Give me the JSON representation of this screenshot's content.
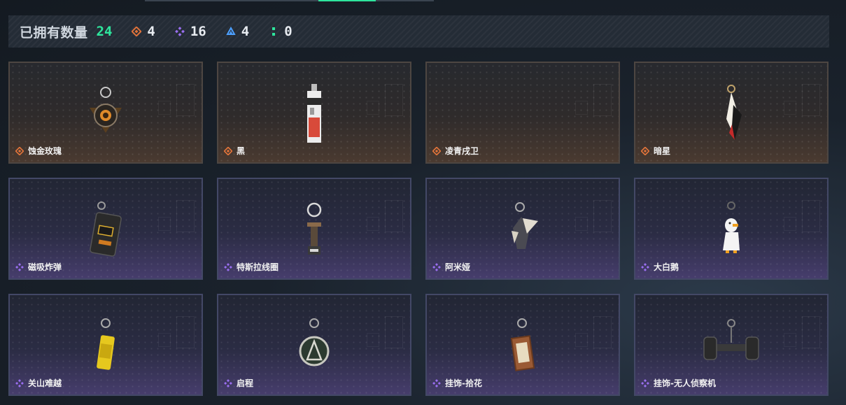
{
  "summary": {
    "label": "已拥有数量",
    "total": "24",
    "rarities": [
      {
        "icon": "orange-diamond-icon",
        "color": "#e0733a",
        "count": "4"
      },
      {
        "icon": "purple-diamond-icon",
        "color": "#9a6ff0",
        "count": "16"
      },
      {
        "icon": "blue-triangle-icon",
        "color": "#4ca0ff",
        "count": "4"
      },
      {
        "icon": "green-dots-icon",
        "color": "#2ee59d",
        "count": "0"
      }
    ]
  },
  "items": [
    {
      "name": "蚀金玫瑰",
      "rarity": "orange"
    },
    {
      "name": "黑",
      "rarity": "orange"
    },
    {
      "name": "凌青戌卫",
      "rarity": "orange"
    },
    {
      "name": "暗星",
      "rarity": "orange"
    },
    {
      "name": "磁吸炸弹",
      "rarity": "purple"
    },
    {
      "name": "特斯拉线圈",
      "rarity": "purple"
    },
    {
      "name": "阿米娅",
      "rarity": "purple"
    },
    {
      "name": "大白鹅",
      "rarity": "purple"
    },
    {
      "name": "关山难越",
      "rarity": "purple"
    },
    {
      "name": "启程",
      "rarity": "purple"
    },
    {
      "name": "挂饰-拾花",
      "rarity": "purple"
    },
    {
      "name": "挂饰-无人侦察机",
      "rarity": "purple"
    }
  ]
}
